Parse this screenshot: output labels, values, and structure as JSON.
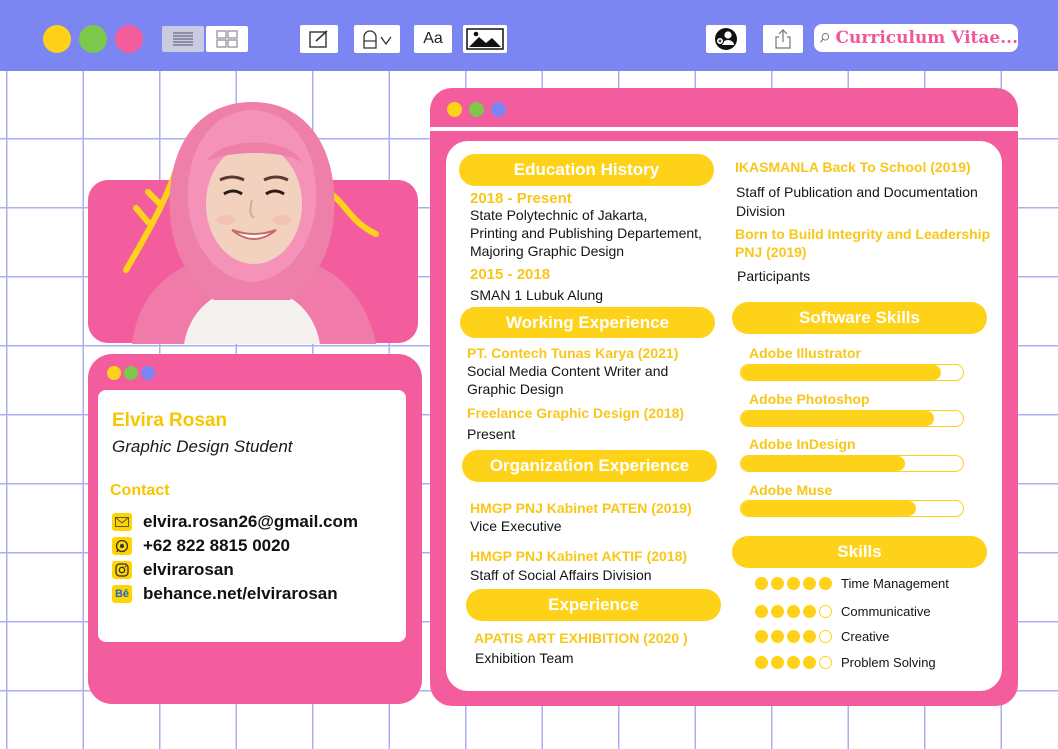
{
  "search": {
    "query": "Curriculum Vitae..."
  },
  "colors": {
    "pink": "#f35d9d",
    "yellow": "#ffd21a",
    "toolbar": "#7b86f2",
    "purple": "#7b86f2",
    "green": "#7cc84a"
  },
  "toolbar": {
    "window_dots": [
      "yellow",
      "green",
      "pink"
    ],
    "icons": [
      "list-view-icon",
      "grid-view-icon",
      "edit-icon",
      "shape-icon",
      "font-icon",
      "image-icon",
      "users-icon",
      "share-icon",
      "search-icon"
    ],
    "font_label": "Aa"
  },
  "profile": {
    "name": "Elvira Rosan",
    "role": "Graphic Design Student",
    "contact_heading": "Contact",
    "contacts": [
      {
        "icon": "email-icon",
        "value": "elvira.rosan26@gmail.com"
      },
      {
        "icon": "whatsapp-icon",
        "value": "+62 822 8815 0020"
      },
      {
        "icon": "instagram-icon",
        "value": "elvirarosan"
      },
      {
        "icon": "behance-icon",
        "label": "Bē",
        "value": "behance.net/elvirarosan"
      }
    ]
  },
  "education": {
    "heading": "Education History",
    "entries": [
      {
        "period": "2018 - Present",
        "lines": [
          "State Polytechnic of Jakarta,",
          "Printing and Publishing Departement,",
          "Majoring Graphic Design"
        ]
      },
      {
        "period": "2015 - 2018",
        "lines": [
          "SMAN 1 Lubuk Alung"
        ]
      }
    ]
  },
  "work": {
    "heading": "Working Experience",
    "entries": [
      {
        "title": "PT. Contech Tunas Karya (2021)",
        "lines": [
          "Social Media Content Writer and",
          "Graphic Design"
        ]
      },
      {
        "title": "Freelance Graphic Design (2018)",
        "lines": [
          "Present"
        ]
      }
    ]
  },
  "organization": {
    "heading": "Organization Experience",
    "entries": [
      {
        "title": "HMGP PNJ Kabinet PATEN (2019)",
        "lines": [
          "Vice Executive"
        ]
      },
      {
        "title": "HMGP PNJ Kabinet AKTIF (2018)",
        "lines": [
          "Staff of Social Affairs Division"
        ]
      }
    ]
  },
  "experience": {
    "heading": "Experience",
    "entries": [
      {
        "title": "APATIS ART EXHIBITION (2020 )",
        "lines": [
          "Exhibition Team"
        ]
      }
    ]
  },
  "events": {
    "entries": [
      {
        "title": "IKASMANLA Back To School (2019)",
        "lines": [
          "Staff of Publication and Documentation",
          "Division"
        ]
      },
      {
        "title_lines": [
          "Born to Build Integrity and Leadership",
          "PNJ (2019)"
        ],
        "lines": [
          "Participants"
        ]
      }
    ]
  },
  "software": {
    "heading": "Software Skills",
    "items": [
      {
        "name": "Adobe Illustrator",
        "level": 0.9
      },
      {
        "name": "Adobe Photoshop",
        "level": 0.87
      },
      {
        "name": "Adobe InDesign",
        "level": 0.74
      },
      {
        "name": "Adobe Muse",
        "level": 0.79
      }
    ]
  },
  "skills": {
    "heading": "Skills",
    "max": 5,
    "items": [
      {
        "name": "Time Management",
        "rating": 5
      },
      {
        "name": "Communicative",
        "rating": 4
      },
      {
        "name": "Creative",
        "rating": 4
      },
      {
        "name": "Problem Solving",
        "rating": 4
      }
    ]
  }
}
